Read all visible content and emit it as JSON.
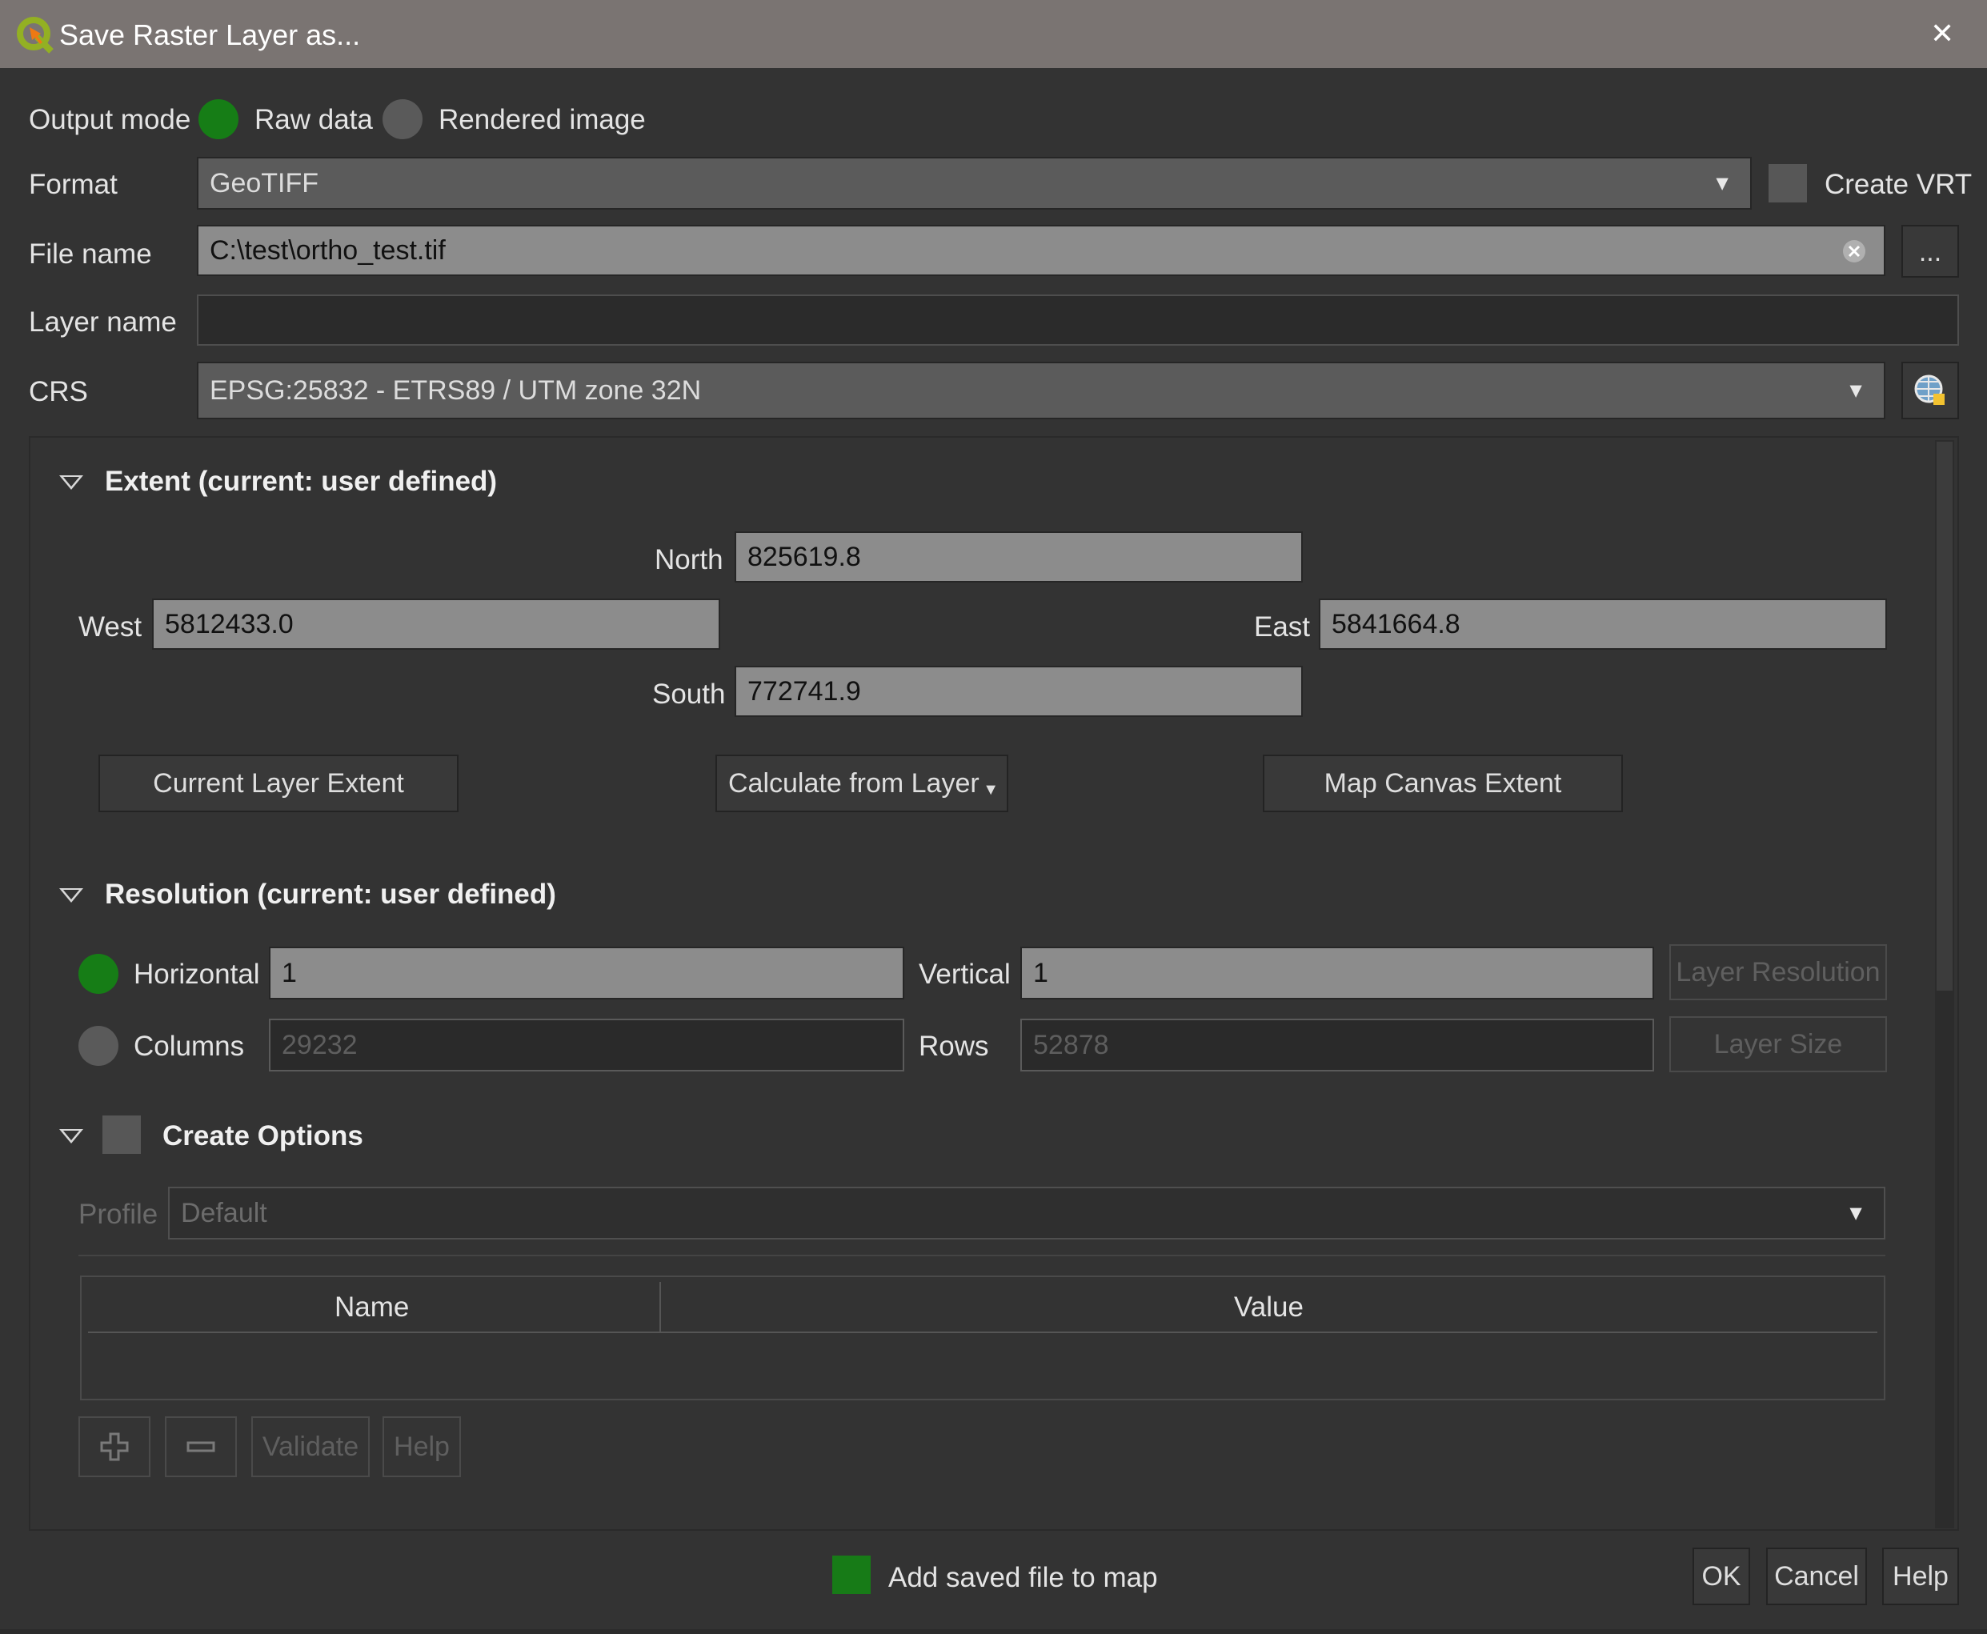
{
  "window": {
    "title": "Save Raster Layer as...",
    "close_symbol": "✕"
  },
  "output_mode": {
    "label": "Output mode",
    "options": [
      "Raw data",
      "Rendered image"
    ],
    "selected": "Raw data"
  },
  "format": {
    "label": "Format",
    "value": "GeoTIFF",
    "create_vrt_label": "Create VRT",
    "create_vrt_checked": false
  },
  "file_name": {
    "label": "File name",
    "value": "C:\\test\\ortho_test.tif",
    "browse_label": "..."
  },
  "layer_name": {
    "label": "Layer name",
    "value": ""
  },
  "crs": {
    "label": "CRS",
    "value": "EPSG:25832 - ETRS89 / UTM zone 32N"
  },
  "extent": {
    "title": "Extent (current: user defined)",
    "north_label": "North",
    "north": "825619.8",
    "west_label": "West",
    "west": "5812433.0",
    "east_label": "East",
    "east": "5841664.8",
    "south_label": "South",
    "south": "772741.9",
    "buttons": {
      "current_layer": "Current Layer Extent",
      "calc_from_layer": "Calculate from Layer",
      "map_canvas": "Map Canvas Extent"
    }
  },
  "resolution": {
    "title": "Resolution (current: user defined)",
    "horizontal_label": "Horizontal",
    "horizontal": "1",
    "vertical_label": "Vertical",
    "vertical": "1",
    "layer_resolution_label": "Layer Resolution",
    "columns_label": "Columns",
    "columns": "29232",
    "rows_label": "Rows",
    "rows": "52878",
    "layer_size_label": "Layer Size",
    "selected": "Horizontal"
  },
  "create_options": {
    "title": "Create Options",
    "checked": false,
    "profile_label": "Profile",
    "profile_value": "Default",
    "table_headers": [
      "Name",
      "Value"
    ],
    "validate_label": "Validate",
    "help_label": "Help"
  },
  "footer": {
    "add_to_map_label": "Add saved file to map",
    "add_to_map_checked": true,
    "ok": "OK",
    "cancel": "Cancel",
    "help": "Help"
  },
  "colors": {
    "titlebar": "#7a7472",
    "background": "#333333",
    "accent_green": "#167d16",
    "field_bg": "#8c8c8c"
  }
}
